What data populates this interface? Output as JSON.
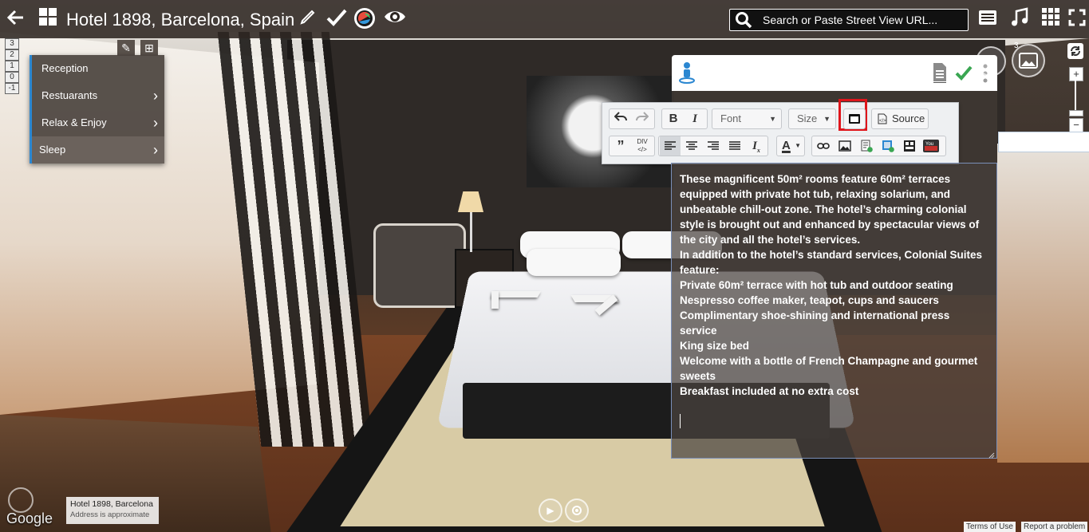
{
  "header": {
    "title": "Hotel 1898, Barcelona, Spain",
    "search_placeholder": "Search or Paste Street View URL..."
  },
  "levels": [
    "3",
    "2",
    "1",
    "0",
    "-1"
  ],
  "menu": {
    "items": [
      {
        "label": "Reception",
        "has_submenu": false
      },
      {
        "label": "Restuarants",
        "has_submenu": true
      },
      {
        "label": "Relax & Enjoy",
        "has_submenu": true
      },
      {
        "label": "Sleep",
        "has_submenu": true,
        "active": true
      }
    ],
    "chevron": "›"
  },
  "toolbar": {
    "font_label": "Font",
    "size_label": "Size",
    "source_label": "Source",
    "div_label": "DIV"
  },
  "editor": {
    "lines": [
      "These magnificent 50m² rooms feature 60m² terraces equipped with private hot tub, relaxing solarium, and unbeatable chill-out zone. The hotel’s charming colonial style is brought out and enhanced by spectacular views of the city and all the hotel’s services.",
      "In addition to the hotel’s standard services, Colonial Suites feature:",
      "Private 60m² terrace with hot tub and outdoor seating",
      "Nespresso coffee maker, teapot, cups and saucers",
      "Complimentary shoe-shining and international press service",
      "King size bed",
      "Welcome with a bottle of French Champagne and gourmet sweets",
      "Breakfast included at no extra cost"
    ]
  },
  "gallery_badge": "3",
  "address": {
    "name": "Hotel 1898, Barcelona",
    "note": "Address is approximate"
  },
  "footer": {
    "brand": "Google",
    "terms": "Terms of Use",
    "report": "Report a problem"
  },
  "colors": {
    "accent": "#2b87d1",
    "highlight_box": "#e0151b",
    "check_green": "#3aa652",
    "topbar": "#2d2621"
  },
  "icons": {
    "back": "arrow-left-icon",
    "apps": "grid-icon",
    "edit": "pencil-icon",
    "check": "check-icon",
    "eye": "eye-icon",
    "music": "music-note-icon",
    "fullscreen": "fullscreen-icon"
  }
}
